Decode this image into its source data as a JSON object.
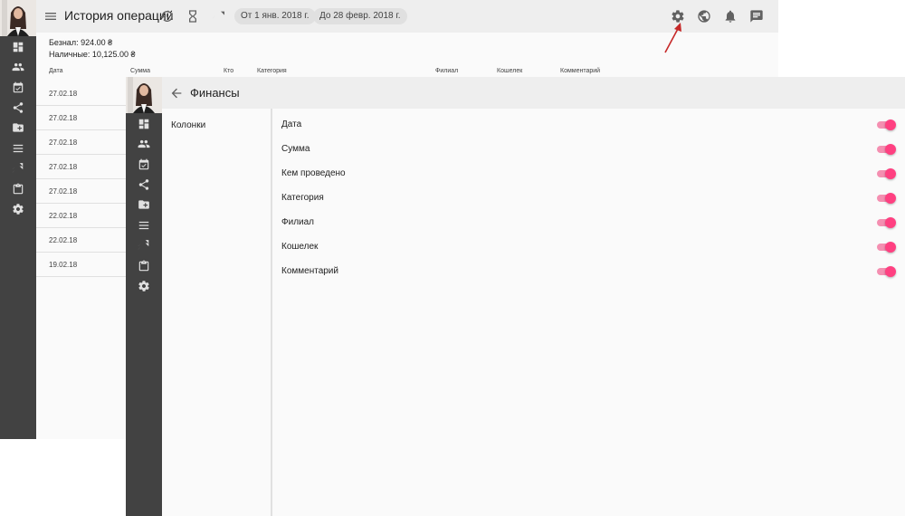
{
  "back_window": {
    "title": "История операций",
    "date_from": "От 1 янв. 2018 г.",
    "date_to": "До 28 февр. 2018 г.",
    "balance_noncash": "Безнал: 924.00 ₴",
    "balance_cash": "Наличные: 10,125.00 ₴",
    "columns": [
      "Дата",
      "Сумма",
      "Кто",
      "Категория",
      "Филиал",
      "Кошелек",
      "Комментарий"
    ],
    "rows": [
      "27.02.18",
      "27.02.18",
      "27.02.18",
      "27.02.18",
      "27.02.18",
      "22.02.18",
      "22.02.18",
      "19.02.18"
    ]
  },
  "front_window": {
    "title": "Финансы",
    "left_item": "Колонки",
    "settings": [
      {
        "label": "Дата",
        "enabled": true
      },
      {
        "label": "Сумма",
        "enabled": true
      },
      {
        "label": "Кем проведено",
        "enabled": true
      },
      {
        "label": "Категория",
        "enabled": true
      },
      {
        "label": "Филиал",
        "enabled": true
      },
      {
        "label": "Кошелек",
        "enabled": true
      },
      {
        "label": "Комментарий",
        "enabled": true
      }
    ]
  },
  "sidebar_icons": [
    "dashboard-icon",
    "people-icon",
    "calendar-check-icon",
    "share-icon",
    "folder-add-icon",
    "list-icon",
    "trending-icon",
    "clipboard-icon",
    "settings-icon"
  ],
  "topbar_icons": [
    "menu-icon",
    "history-icon",
    "hourglass-icon",
    "trend-icon",
    "settings-icon",
    "globe-icon",
    "bell-icon",
    "chat-icon"
  ],
  "colors": {
    "sidebar": "#424242",
    "toggle_on": "#ff4081",
    "annotation_arrow": "#c62828"
  }
}
